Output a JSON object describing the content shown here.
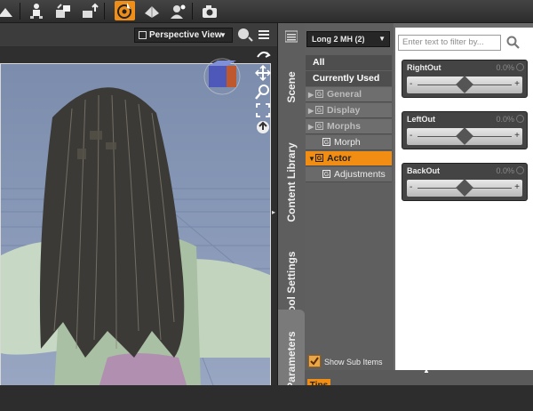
{
  "toolbar": {
    "icons": [
      "pose-icon",
      "figure-icon",
      "morph-icon",
      "export-icon",
      "universal-tool-icon",
      "smoothing-icon",
      "group-icon",
      "render-icon"
    ]
  },
  "viewport": {
    "camera_label": "Perspective View",
    "camera_caret": "▼"
  },
  "tabs": [
    "Scene",
    "Content Library",
    "Tool Settings",
    "Parameters"
  ],
  "preset": {
    "label": "Long 2 MH (2)"
  },
  "tree": {
    "all": "All",
    "currently_used": "Currently Used",
    "general": "General",
    "display": "Display",
    "morphs": "Morphs",
    "morph_loader": "Morph Loader",
    "actor": "Actor",
    "adjustments": "Adjustments",
    "group_glyph": "G"
  },
  "filter": {
    "placeholder": "Enter text to filter by..."
  },
  "sliders": [
    {
      "label": "RightOut",
      "value": "0.0%",
      "position": 0.5
    },
    {
      "label": "LeftOut",
      "value": "0.0%",
      "position": 0.5
    },
    {
      "label": "BackOut",
      "value": "0.0%",
      "position": 0.5
    }
  ],
  "footer": {
    "show_sub_items": "Show Sub Items",
    "tips": "Tips"
  },
  "colors": {
    "accent": "#f08d12",
    "scene_bg": "#8797b6",
    "panel_bg": "#6b6b6b"
  }
}
